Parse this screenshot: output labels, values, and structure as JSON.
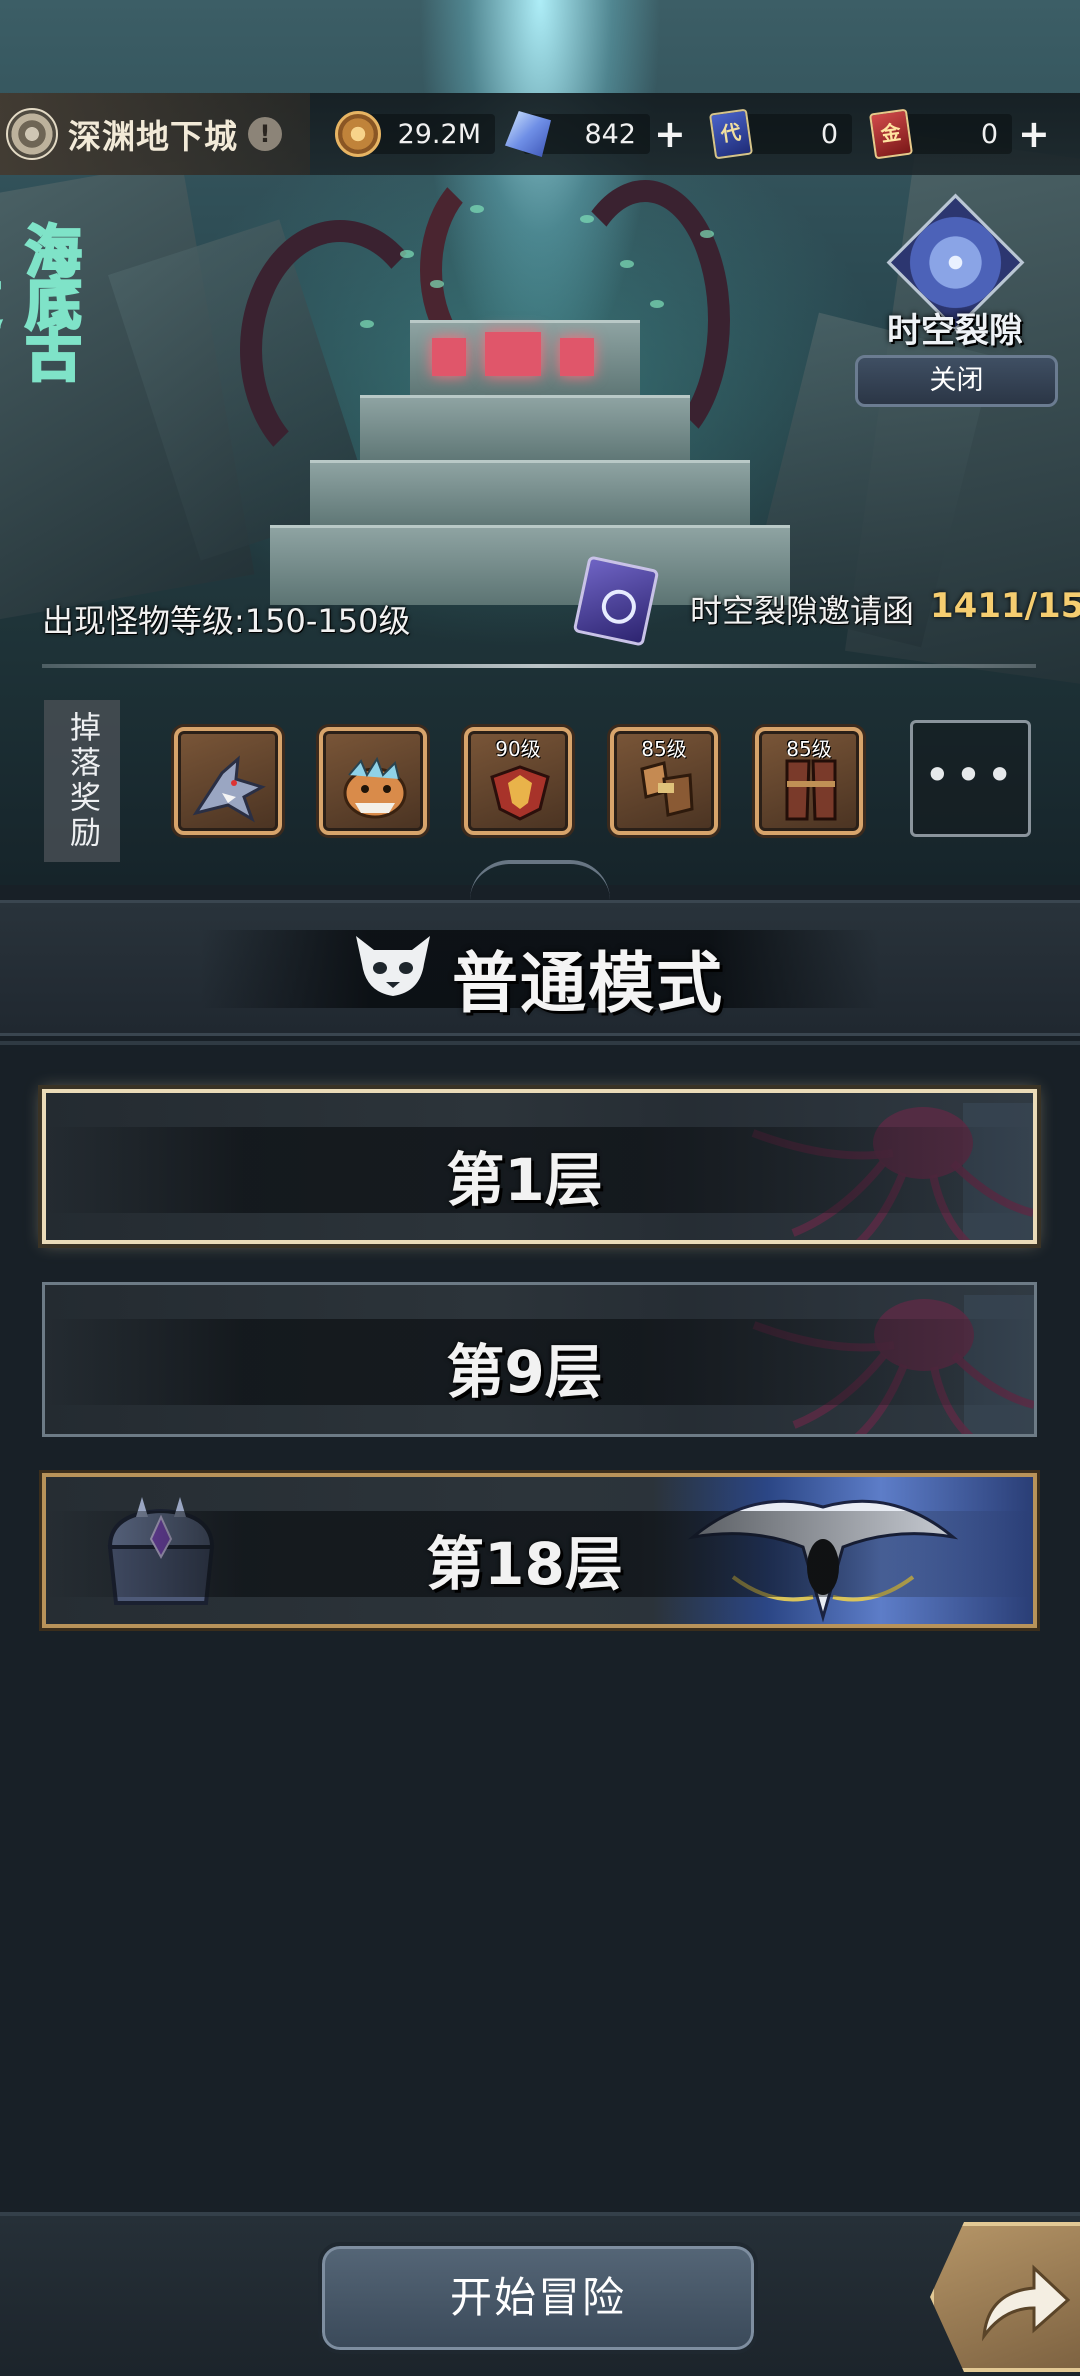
{
  "topbar": {
    "dungeon_name": "深渊地下城",
    "alert": "!",
    "currencies": [
      {
        "icon": "gold-coin-icon",
        "value": "29.2M",
        "has_plus": false
      },
      {
        "icon": "crystal-icon",
        "value": "842",
        "has_plus": true
      },
      {
        "icon": "blue-card-icon",
        "glyph": "代",
        "value": "0",
        "has_plus": false
      },
      {
        "icon": "red-card-icon",
        "glyph": "金",
        "value": "0",
        "has_plus": true
      }
    ]
  },
  "zone": {
    "name": "海底古道"
  },
  "rift": {
    "label": "时空裂隙",
    "toggle_label": "关闭"
  },
  "info": {
    "monster_level": "出现怪物等级:150-150级",
    "invite_label": "时空裂隙邀请函",
    "invite_count": "1411/15"
  },
  "drops": {
    "label": "掉落奖励",
    "items": [
      {
        "icon": "shark-monster-icon",
        "level": ""
      },
      {
        "icon": "dinosaur-monster-icon",
        "level": ""
      },
      {
        "icon": "shoulder-armor-icon",
        "level": "90级"
      },
      {
        "icon": "gauntlet-icon",
        "level": "85级"
      },
      {
        "icon": "leg-armor-icon",
        "level": "85级"
      }
    ],
    "more": "•••"
  },
  "mode": {
    "title": "普通模式"
  },
  "floors": [
    {
      "label": "第1层",
      "selected": true,
      "boss": false
    },
    {
      "label": "第9层",
      "selected": false,
      "boss": false
    },
    {
      "label": "第18层",
      "selected": false,
      "boss": true
    }
  ],
  "actions": {
    "start": "开始冒险"
  },
  "colors": {
    "accent_gold": "#f5cd70",
    "frame_gold": "#d7a46b",
    "selected_border": "#eadbb8"
  }
}
